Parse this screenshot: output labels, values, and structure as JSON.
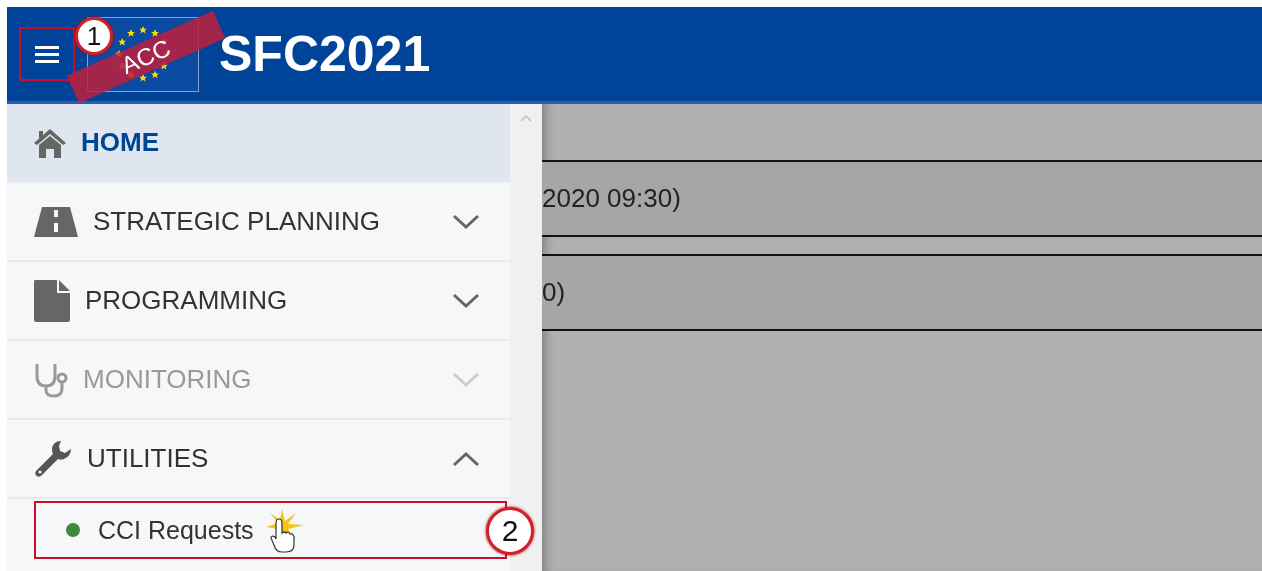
{
  "header": {
    "menu_button": {
      "callout": "1"
    },
    "logo": {
      "stamp": "ACC"
    },
    "title": "SFC2021"
  },
  "nav": {
    "items": [
      {
        "label": "HOME",
        "kind": "link",
        "selected": true,
        "disabled": false
      },
      {
        "label": "STRATEGIC PLANNING",
        "kind": "group",
        "selected": false,
        "disabled": false,
        "expanded": false
      },
      {
        "label": "PROGRAMMING",
        "kind": "group",
        "selected": false,
        "disabled": false,
        "expanded": false
      },
      {
        "label": "MONITORING",
        "kind": "group",
        "selected": false,
        "disabled": true,
        "expanded": false
      },
      {
        "label": "UTILITIES",
        "kind": "group",
        "selected": false,
        "disabled": false,
        "expanded": true,
        "children": [
          {
            "label": "CCI Requests",
            "color": "#3f8a3c",
            "callout": "2",
            "highlighted": true
          }
        ]
      }
    ]
  },
  "content": {
    "rows": [
      "2020 09:30)",
      "0)"
    ]
  }
}
